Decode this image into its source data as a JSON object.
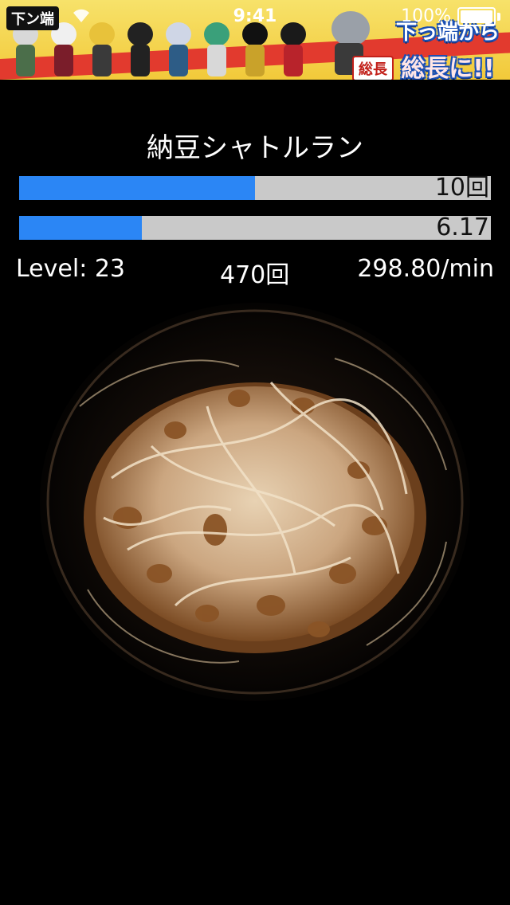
{
  "status_bar": {
    "time": "9:41",
    "battery": "100%"
  },
  "ad": {
    "badge": "下ン端",
    "title_line1": "下っ端から",
    "title_line2": "総長に!!",
    "stamp": "総長"
  },
  "app": {
    "title": "納豆シャトルラン"
  },
  "bar1": {
    "label": "10回",
    "progress": 0.5
  },
  "bar2": {
    "label": "6.17",
    "progress": 0.26
  },
  "stats": {
    "level": "Level: 23",
    "count": "470回",
    "rate": "298.80/min"
  },
  "colors": {
    "bar_fill": "#2b86f5",
    "bar_track": "#c9c9c9",
    "background": "#000000",
    "ad_background": "#f2c93a"
  }
}
